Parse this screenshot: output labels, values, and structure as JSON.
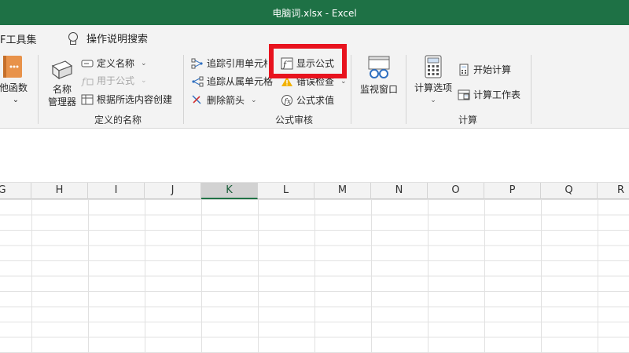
{
  "window": {
    "title": "电脑词.xlsx  -  Excel"
  },
  "menubar": {
    "pdf_tab": "F工具集",
    "tell_me": "操作说明搜索"
  },
  "ribbon": {
    "other_functions": {
      "label1": "其他函数",
      "caret": "⌄"
    },
    "names_group": {
      "label": "定义的名称",
      "name_manager": [
        "名称",
        "管理器"
      ],
      "define_name": "定义名称",
      "use_in_formula": "用于公式",
      "create_from_selection": "根据所选内容创建"
    },
    "audit_group": {
      "label": "公式审核",
      "trace_precedents": "追踪引用单元格",
      "trace_dependents": "追踪从属单元格",
      "remove_arrows": "删除箭头",
      "show_formulas": "显示公式",
      "error_checking": "错误检查",
      "evaluate_formula": "公式求值",
      "watch_window": "监视窗口"
    },
    "calc_group": {
      "label": "计算",
      "calc_options": "计算选项",
      "calc_now": "开始计算",
      "calc_sheet": "计算工作表"
    }
  },
  "columns": [
    "G",
    "H",
    "I",
    "J",
    "K",
    "L",
    "M",
    "N",
    "O",
    "P",
    "Q",
    "R"
  ],
  "selected_column": "K",
  "colors": {
    "excel_green": "#1e7145",
    "highlight_red": "#e8131e"
  }
}
